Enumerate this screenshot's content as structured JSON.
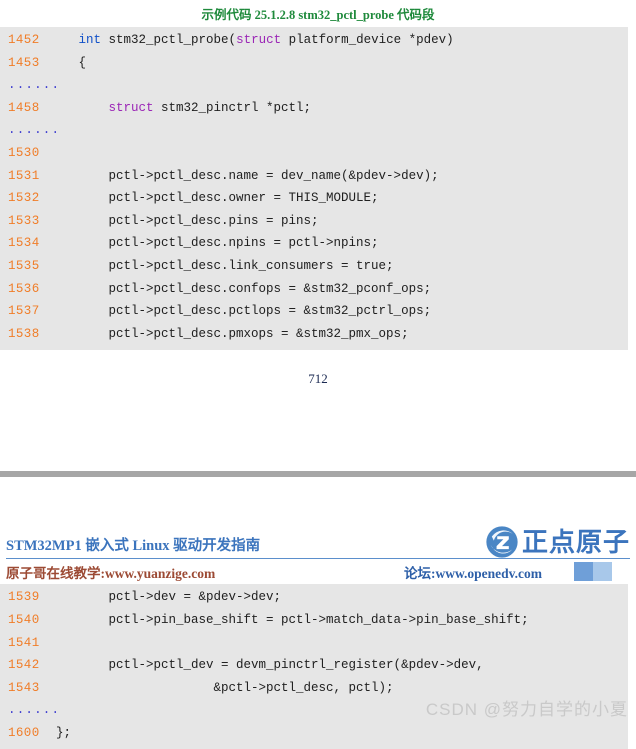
{
  "document": {
    "page_number": "712",
    "watermark": "CSDN @努力自学的小夏"
  },
  "code_listing_1": {
    "caption": "示例代码 25.1.2.8 stm32_pctl_probe 代码段",
    "lines": [
      {
        "num": "1452",
        "indent": "   ",
        "code": "int stm32_pctl_probe(struct platform_device *pdev)"
      },
      {
        "num": "1453",
        "indent": "   ",
        "code": "{"
      },
      {
        "num": "......",
        "indent": "",
        "code": ""
      },
      {
        "num": "1458",
        "indent": "       ",
        "code": "struct stm32_pinctrl *pctl;"
      },
      {
        "num": "......",
        "indent": "",
        "code": ""
      },
      {
        "num": "1530",
        "indent": "",
        "code": ""
      },
      {
        "num": "1531",
        "indent": "       ",
        "code": "pctl->pctl_desc.name = dev_name(&pdev->dev);"
      },
      {
        "num": "1532",
        "indent": "       ",
        "code": "pctl->pctl_desc.owner = THIS_MODULE;"
      },
      {
        "num": "1533",
        "indent": "       ",
        "code": "pctl->pctl_desc.pins = pins;"
      },
      {
        "num": "1534",
        "indent": "       ",
        "code": "pctl->pctl_desc.npins = pctl->npins;"
      },
      {
        "num": "1535",
        "indent": "       ",
        "code": "pctl->pctl_desc.link_consumers = true;"
      },
      {
        "num": "1536",
        "indent": "       ",
        "code": "pctl->pctl_desc.confops = &stm32_pconf_ops;"
      },
      {
        "num": "1537",
        "indent": "       ",
        "code": "pctl->pctl_desc.pctlops = &stm32_pctrl_ops;"
      },
      {
        "num": "1538",
        "indent": "       ",
        "code": "pctl->pctl_desc.pmxops = &stm32_pmx_ops;"
      }
    ]
  },
  "header": {
    "title": "STM32MP1 嵌入式 Linux 驱动开发指南",
    "brand_text": "正点原子",
    "left_link": "原子哥在线教学:www.yuanzige.com",
    "right_link": "论坛:www.openedv.com"
  },
  "code_listing_2": {
    "lines": [
      {
        "num": "1539",
        "indent": "       ",
        "code": "pctl->dev = &pdev->dev;"
      },
      {
        "num": "1540",
        "indent": "       ",
        "code": "pctl->pin_base_shift = pctl->match_data->pin_base_shift;"
      },
      {
        "num": "1541",
        "indent": "",
        "code": ""
      },
      {
        "num": "1542",
        "indent": "       ",
        "code": "pctl->pctl_dev = devm_pinctrl_register(&pdev->dev,"
      },
      {
        "num": "1543",
        "indent": "                     ",
        "code": "&pctl->pctl_desc, pctl);"
      },
      {
        "num": "......",
        "indent": "",
        "code": ""
      },
      {
        "num": "1600",
        "indent": "",
        "code": "};"
      }
    ]
  },
  "colors": {
    "line_number": "#f07d28",
    "keyword_blue": "#1050c8",
    "keyword_purple": "#9b26b6",
    "caption_green": "#1f8a3c",
    "brand_blue": "#3b74bd",
    "code_background": "#e6e6e6"
  }
}
